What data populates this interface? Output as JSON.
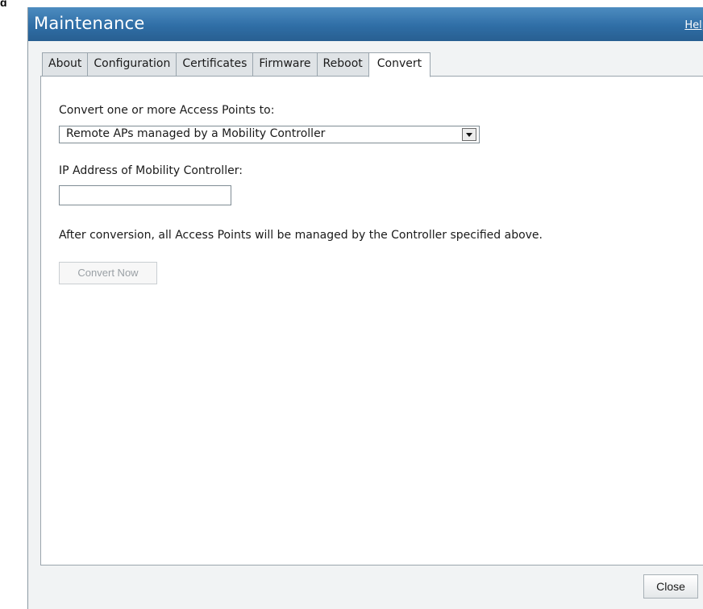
{
  "figure_label": "g",
  "dialog": {
    "title": "Maintenance",
    "help_link": "Help",
    "close_label": "Close"
  },
  "tabs": [
    {
      "label": "About",
      "active": false
    },
    {
      "label": "Configuration",
      "active": false
    },
    {
      "label": "Certificates",
      "active": false
    },
    {
      "label": "Firmware",
      "active": false
    },
    {
      "label": "Reboot",
      "active": false
    },
    {
      "label": "Convert",
      "active": true
    }
  ],
  "convert": {
    "convert_to_label": "Convert one or more Access Points to:",
    "convert_to_selected": "Remote APs managed by a Mobility Controller",
    "ip_label": "IP Address of Mobility Controller:",
    "ip_value": "",
    "note": "After conversion, all Access Points will be managed by the Controller specified above.",
    "convert_button": "Convert Now"
  },
  "colors": {
    "titlebar": "#2f6ea6",
    "dialog_bg": "#f1f3f4",
    "tab_bg": "#dfe3e6",
    "disabled_text": "#9aa0a5"
  }
}
